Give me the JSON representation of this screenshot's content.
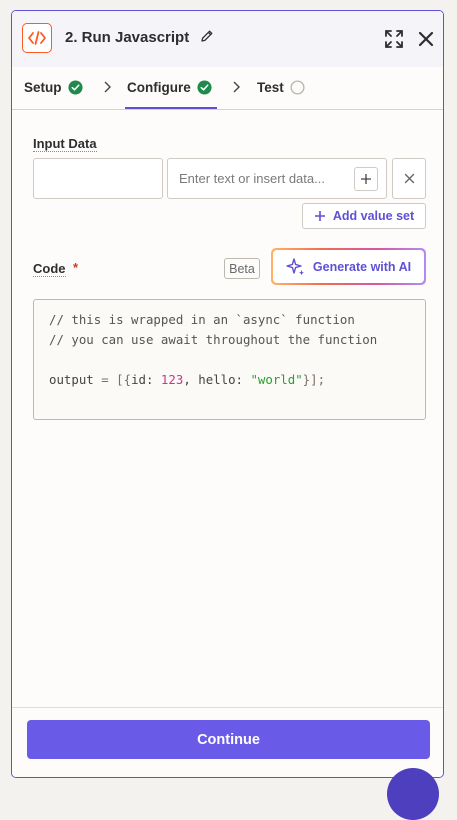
{
  "header": {
    "title": "2. Run Javascript",
    "accent_color": "#ff5a1f",
    "icons": [
      "code-icon",
      "pencil-icon",
      "expand-icon",
      "close-icon"
    ]
  },
  "tabs": [
    {
      "label": "Setup",
      "status": "complete"
    },
    {
      "label": "Configure",
      "status": "complete",
      "active": true
    },
    {
      "label": "Test",
      "status": "pending"
    }
  ],
  "input_data": {
    "label": "Input Data",
    "key_value": "",
    "value_placeholder": "Enter text or insert data...",
    "add_value_label": "Add value set"
  },
  "code": {
    "label": "Code",
    "required_mark": "*",
    "beta_label": "Beta",
    "generate_label": "Generate with AI",
    "comment_1": "// this is wrapped in an `async` function",
    "comment_2": "// you can use await throughout the function",
    "line_output": "output",
    "line_eq": " = [{",
    "line_id_key": "id: ",
    "line_id_val": "123",
    "line_sep": ", hello: ",
    "line_hello_val": "\"world\"",
    "line_end": "}];"
  },
  "footer": {
    "continue_label": "Continue",
    "primary_color": "#695be8"
  }
}
